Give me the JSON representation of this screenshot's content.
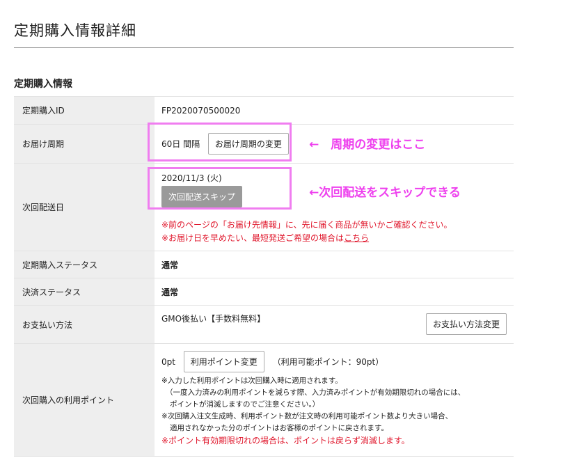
{
  "page": {
    "title": "定期購入情報詳細"
  },
  "section": {
    "title": "定期購入情報"
  },
  "rows": {
    "id": {
      "label": "定期購入ID",
      "value": "FP2020070500020"
    },
    "cycle": {
      "label": "お届け周期",
      "value": "60日 間隔",
      "button": "お届け周期の変更"
    },
    "next_date": {
      "label": "次回配送日",
      "value": "2020/11/3 (火)",
      "button": "次回配送スキップ",
      "note1": "※前のページの「お届け先情報」に、先に届く商品が無いかご確認ください。",
      "note2_prefix": "※お届け日を早めたい、最短発送ご希望の場合は",
      "note2_link": "こちら"
    },
    "purchase_status": {
      "label": "定期購入ステータス",
      "value": "通常"
    },
    "payment_status": {
      "label": "決済ステータス",
      "value": "通常"
    },
    "payment_method": {
      "label": "お支払い方法",
      "value": "GMO後払い【手数料無料】",
      "button": "お支払い方法変更"
    },
    "points": {
      "label": "次回購入の利用ポイント",
      "value": "0pt",
      "button": "利用ポイント変更",
      "available": "（利用可能ポイント：90pt）",
      "note1": "※入力した利用ポイントは次回購入時に適用されます。",
      "note2": "（一度入力済みの利用ポイントを減らす際、入力済みポイントが有効期限切れの場合には、",
      "note3": "ポイントが消滅しますのでご注意ください。）",
      "note4": "※次回購入注文生成時、利用ポイント数が注文時の利用可能ポイント数より大きい場合、",
      "note5": "適用されなかった分のポイントはお客様のポイントに戻されます。",
      "note6": "※ポイント有効期限切れの場合は、ポイントは戻らず消滅します。"
    }
  },
  "annotations": {
    "cycle_note": "←　周期の変更はここ",
    "skip_note": "←次回配送をスキップできる"
  },
  "colors": {
    "highlight": "#f07df0",
    "annotation": "#ee40ee",
    "warning": "#e0182d"
  }
}
